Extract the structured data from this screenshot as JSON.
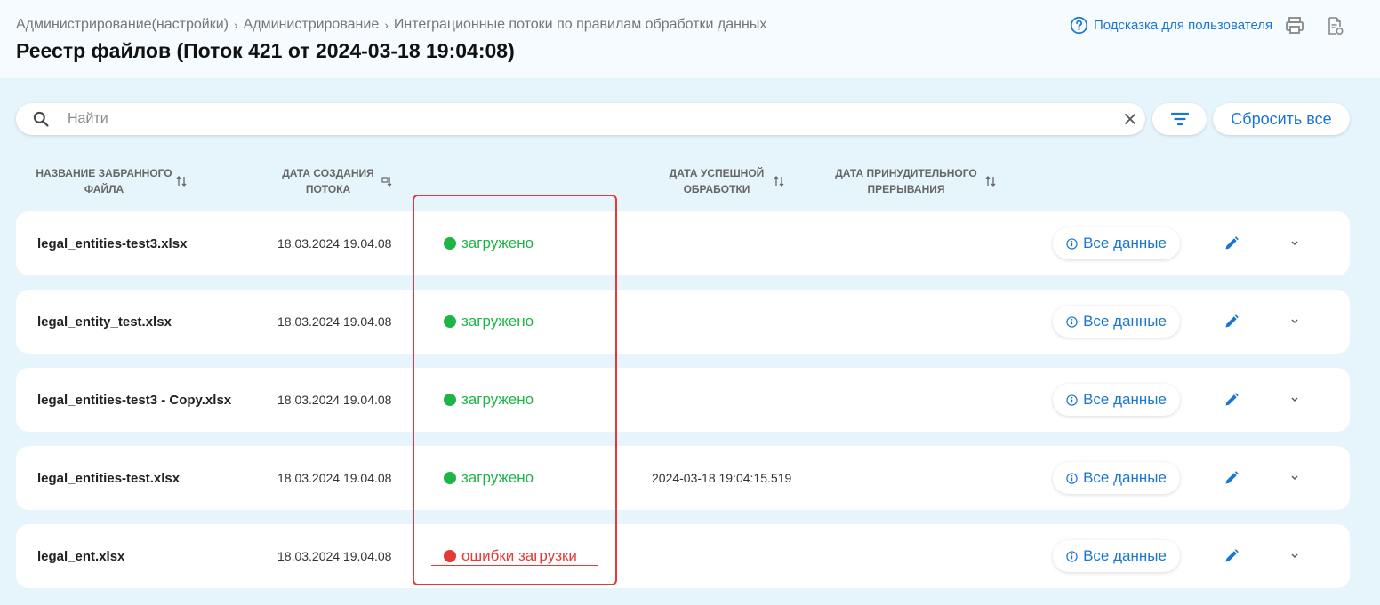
{
  "breadcrumb": [
    "Администрирование(настройки)",
    "Администрирование",
    "Интеграционные потоки по правилам обработки данных"
  ],
  "page_title": "Реестр файлов (Поток 421 от 2024-03-18 19:04:08)",
  "help_label": "Подсказка для пользователя",
  "icons": {
    "help": "help-circle-icon",
    "print": "print-icon",
    "export": "document-export-icon",
    "search": "search-icon",
    "clear": "close-icon",
    "filter": "filter-icon",
    "info": "info-icon",
    "edit": "pencil-icon",
    "expand": "chevron-down-icon",
    "sort": "sort-icon"
  },
  "search": {
    "placeholder": "Найти",
    "value": ""
  },
  "reset_label": "Сбросить все",
  "columns": {
    "file_name": "Название забранного файла",
    "created": "Дата создания потока",
    "success": "Дата успешной обработки",
    "interrupted": "Дата принудительного прерывания"
  },
  "rows": [
    {
      "file": "legal_entities-test3.xlsx",
      "created": "18.03.2024 19.04.08",
      "status": "загружено",
      "status_kind": "ok",
      "success_date": "",
      "interrupted_date": ""
    },
    {
      "file": "legal_entity_test.xlsx",
      "created": "18.03.2024 19.04.08",
      "status": "загружено",
      "status_kind": "ok",
      "success_date": "",
      "interrupted_date": ""
    },
    {
      "file": "legal_entities-test3 - Copy.xlsx",
      "created": "18.03.2024 19.04.08",
      "status": "загружено",
      "status_kind": "ok",
      "success_date": "",
      "interrupted_date": ""
    },
    {
      "file": "legal_entities-test.xlsx",
      "created": "18.03.2024 19.04.08",
      "status": "загружено",
      "status_kind": "ok",
      "success_date": "2024-03-18 19:04:15.519",
      "interrupted_date": ""
    },
    {
      "file": "legal_ent.xlsx",
      "created": "18.03.2024 19.04.08",
      "status": "ошибки загрузки",
      "status_kind": "error",
      "success_date": "",
      "interrupted_date": ""
    }
  ],
  "row_action_label": "Все данные",
  "colors": {
    "accent": "#1976d2",
    "status_ok": "#1db546",
    "status_error": "#e53935",
    "background": "#e6f4fb",
    "header_background": "#f5fbfe"
  }
}
